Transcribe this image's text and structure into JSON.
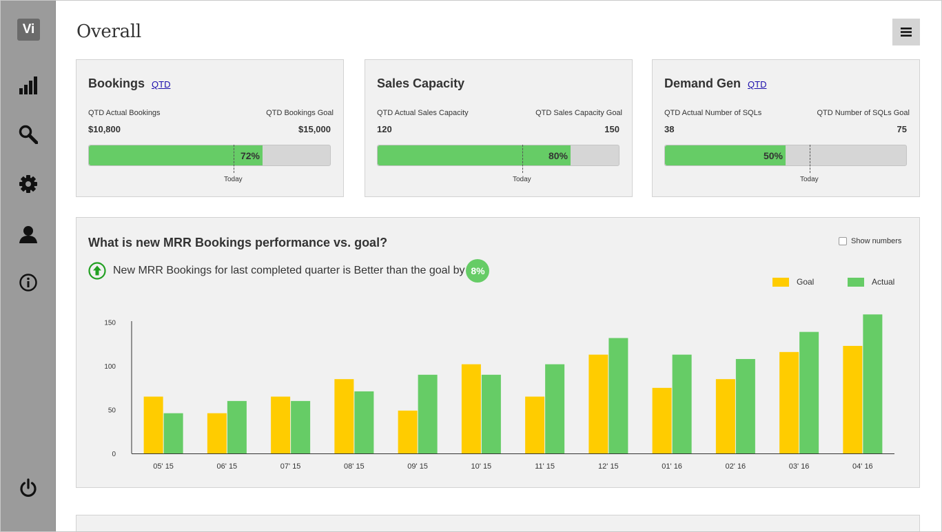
{
  "logo": "Vi",
  "nav": [
    {
      "name": "bar-chart-icon"
    },
    {
      "name": "search-icon"
    },
    {
      "name": "gear-icon"
    },
    {
      "name": "user-icon"
    },
    {
      "name": "info-icon"
    },
    {
      "name": "power-icon"
    }
  ],
  "page_title": "Overall",
  "menu_icon": "hamburger-menu-icon",
  "cards": [
    {
      "title": "Bookings",
      "link": "QTD",
      "actual_label": "QTD Actual Bookings",
      "goal_label": "QTD Bookings Goal",
      "actual_value": "$10,800",
      "goal_value": "$15,000",
      "progress_text": "72%",
      "progress": 0.72,
      "today_fraction": 0.6,
      "today_label": "Today"
    },
    {
      "title": "Sales Capacity",
      "link": "",
      "actual_label": "QTD Actual Sales Capacity",
      "goal_label": "QTD Sales Capacity Goal",
      "actual_value": "120",
      "goal_value": "150",
      "progress_text": "80%",
      "progress": 0.8,
      "today_fraction": 0.6,
      "today_label": "Today"
    },
    {
      "title": "Demand Gen",
      "link": "QTD",
      "actual_label": "QTD Actual Number of SQLs",
      "goal_label": "QTD Number of SQLs Goal",
      "actual_value": "38",
      "goal_value": "75",
      "progress_text": "50%",
      "progress": 0.5,
      "today_fraction": 0.6,
      "today_label": "Today"
    }
  ],
  "performance": {
    "title": "What is new MRR Bookings performance vs. goal?",
    "show_numbers_label": "Show numbers",
    "show_numbers_checked": false,
    "insight_text": "New MRR Bookings for last completed quarter is Better than the goal by",
    "insight_badge": "8%",
    "insight_icon": "arrow-up-circle-icon"
  },
  "colors": {
    "goal": "#ffcc00",
    "actual": "#66cc66",
    "sidebar": "#9b9b9b",
    "panel": "#f1f1f1"
  },
  "chart_data": {
    "type": "bar",
    "categories": [
      "05' 15",
      "06' 15",
      "07' 15",
      "08' 15",
      "09' 15",
      "10' 15",
      "11' 15",
      "12' 15",
      "01' 16",
      "02' 16",
      "03' 16",
      "04' 16"
    ],
    "series": [
      {
        "name": "Goal",
        "values": [
          65,
          46,
          65,
          85,
          49,
          102,
          65,
          113,
          75,
          85,
          116,
          123
        ]
      },
      {
        "name": "Actual",
        "values": [
          46,
          60,
          60,
          71,
          90,
          90,
          102,
          132,
          113,
          108,
          139,
          159
        ]
      }
    ],
    "yticks": [
      0,
      50,
      100,
      150
    ],
    "ylim": [
      0,
      160
    ],
    "legend_position": "top-right",
    "grid": false
  }
}
